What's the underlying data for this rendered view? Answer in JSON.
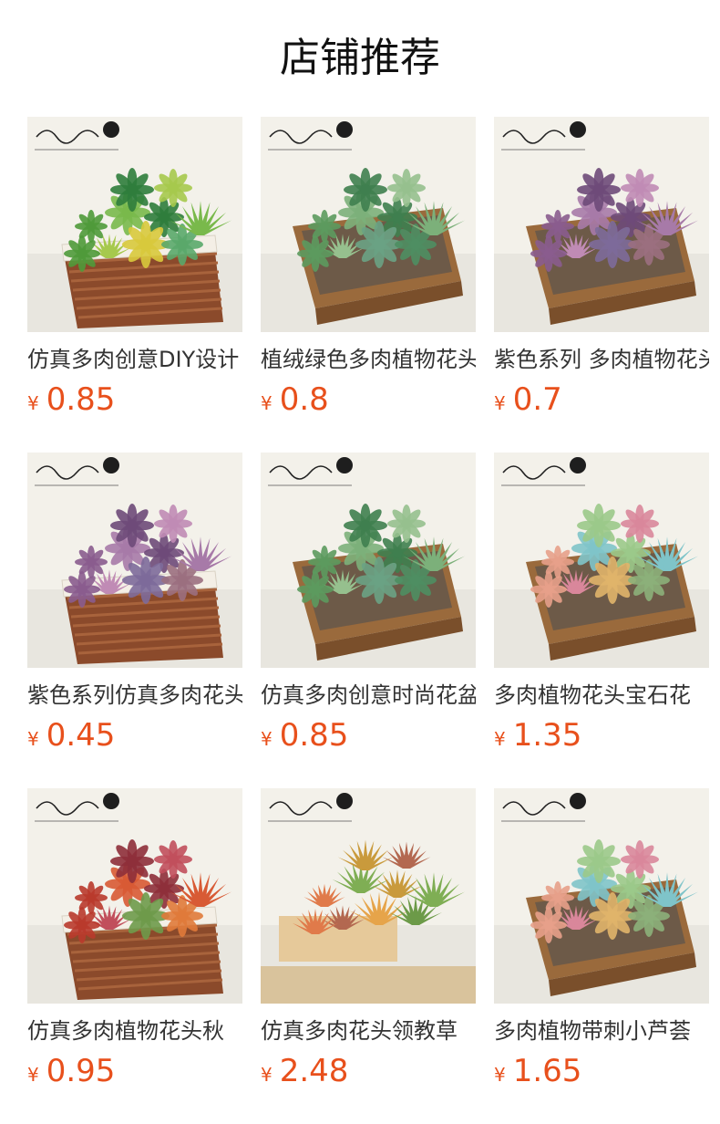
{
  "page": {
    "title": "店铺推荐"
  },
  "theme": {
    "price_color": "#e8501c",
    "text_color": "#333333"
  },
  "products": [
    {
      "name": "仿真多肉创意DIY设计",
      "currency": "¥",
      "price": "0.85",
      "container": "wicker-basket",
      "plants": "mixed-green"
    },
    {
      "name": "植绒绿色多肉植物花头",
      "currency": "¥",
      "price": "0.8",
      "container": "wooden-box",
      "plants": "green"
    },
    {
      "name": "紫色系列 多肉植物花头",
      "currency": "¥",
      "price": "0.7",
      "container": "wooden-box",
      "plants": "purple"
    },
    {
      "name": "紫色系列仿真多肉花头",
      "currency": "¥",
      "price": "0.45",
      "container": "wicker-basket",
      "plants": "purple"
    },
    {
      "name": "仿真多肉创意时尚花盆",
      "currency": "¥",
      "price": "0.85",
      "container": "wooden-box",
      "plants": "green"
    },
    {
      "name": "多肉植物花头宝石花",
      "currency": "¥",
      "price": "1.35",
      "container": "wooden-box",
      "plants": "pastel"
    },
    {
      "name": "仿真多肉植物花头秋",
      "currency": "¥",
      "price": "0.95",
      "container": "wicker-basket",
      "plants": "red"
    },
    {
      "name": "仿真多肉花头领教草",
      "currency": "¥",
      "price": "2.48",
      "container": "wooden-crate",
      "plants": "spiky"
    },
    {
      "name": "多肉植物带刺小芦荟",
      "currency": "¥",
      "price": "1.65",
      "container": "wooden-box",
      "plants": "pastel"
    }
  ]
}
